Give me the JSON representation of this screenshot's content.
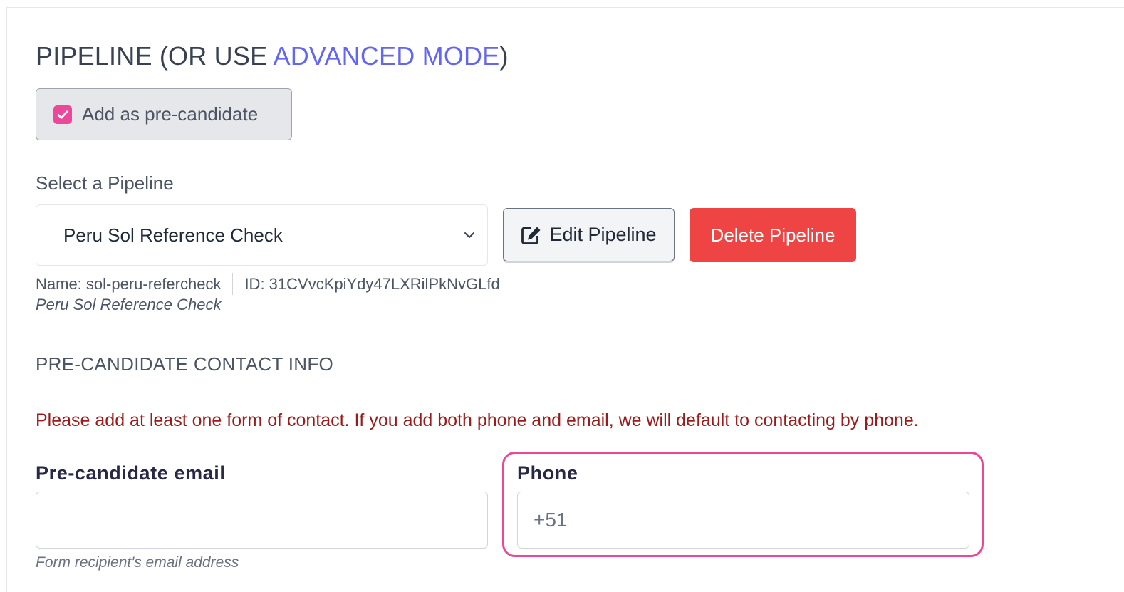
{
  "section": {
    "title_prefix": "PIPELINE (OR USE ",
    "title_link": "ADVANCED MODE",
    "title_suffix": ")"
  },
  "precandidate_toggle": {
    "label": "Add as pre-candidate",
    "checked": true
  },
  "pipeline_select": {
    "label": "Select a Pipeline",
    "selected": "Peru Sol Reference Check"
  },
  "buttons": {
    "edit": "Edit Pipeline",
    "delete": "Delete Pipeline"
  },
  "pipeline_meta": {
    "name": "Name: sol-peru-refercheck",
    "id": "ID: 31CVvcKpiYdy47LXRilPkNvGLfd",
    "description": "Peru Sol Reference Check"
  },
  "contact_section": {
    "heading": "PRE-CANDIDATE CONTACT INFO",
    "warning": "Please add at least one form of contact. If you add both phone and email, we will default to contacting by phone.",
    "email_label": "Pre-candidate email",
    "email_value": "",
    "email_help": "Form recipient's email address",
    "phone_label": "Phone",
    "phone_value": "+51"
  },
  "colors": {
    "accent_link": "#6366f1",
    "checkbox": "#ec4899",
    "delete": "#ef4444",
    "warning": "#991b1b",
    "highlight": "#ec4899"
  }
}
